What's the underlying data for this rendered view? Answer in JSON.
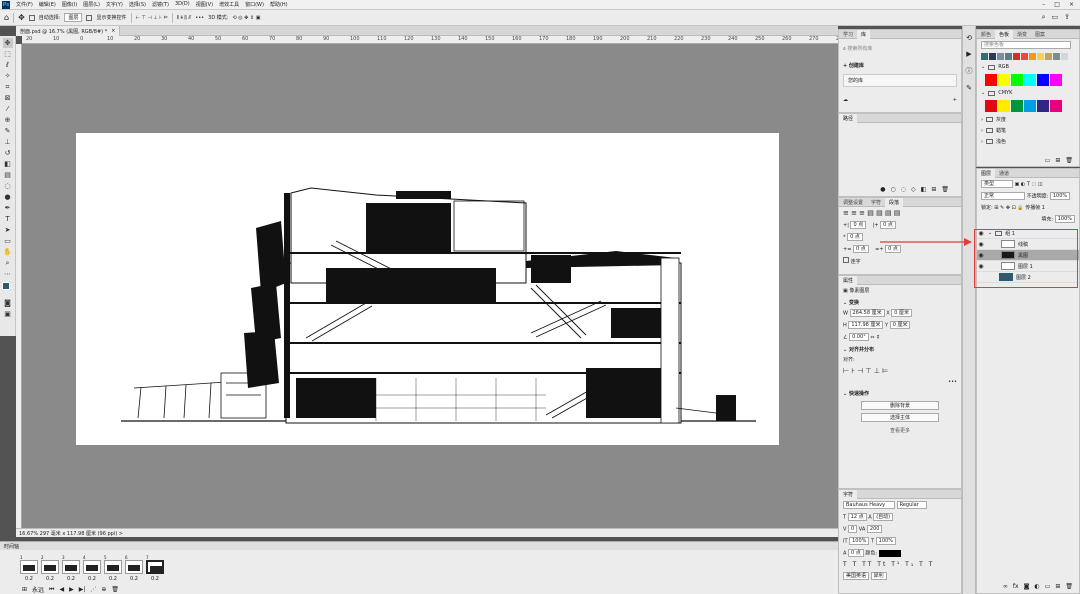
{
  "app": {
    "logo": "Ps"
  },
  "menubar": {
    "items": [
      "文件(F)",
      "编辑(E)",
      "图像(I)",
      "图层(L)",
      "文字(Y)",
      "选择(S)",
      "滤镜(T)",
      "3D(D)",
      "视图(V)",
      "增效工具",
      "窗口(W)",
      "帮助(H)"
    ]
  },
  "options": {
    "auto_select": "自动选择:",
    "auto_select_value": "图层",
    "show_transform": "显示变换控件",
    "mode_3d": "3D 模式:"
  },
  "document": {
    "tab_title": "剖面.psd @ 16.7% (黑图, RGB/8#) *",
    "close": "×"
  },
  "ruler": {
    "h_ticks": [
      "20",
      "10",
      "0",
      "10",
      "20",
      "30",
      "40",
      "50",
      "60",
      "70",
      "80",
      "90",
      "100",
      "110",
      "120",
      "130",
      "140",
      "150",
      "160",
      "170",
      "180",
      "190",
      "200",
      "210",
      "220",
      "230",
      "240",
      "250",
      "260",
      "270",
      "280"
    ]
  },
  "status": {
    "text": "16.67%   297 毫米 x 117.98 厘米 (96 ppi)   >"
  },
  "timeline": {
    "title": "时间轴",
    "frames": [
      {
        "num": "1",
        "delay": "0.2"
      },
      {
        "num": "2",
        "delay": "0.2"
      },
      {
        "num": "3",
        "delay": "0.2"
      },
      {
        "num": "4",
        "delay": "0.2"
      },
      {
        "num": "5",
        "delay": "0.2"
      },
      {
        "num": "6",
        "delay": "0.2"
      },
      {
        "num": "7",
        "delay": "0.2"
      }
    ],
    "loop": "永远"
  },
  "learn_panel": {
    "tabs": [
      "学习",
      "库"
    ],
    "search_placeholder": "搜索所有库",
    "create_new": "+ 创建库",
    "library_name": "您的库"
  },
  "paths_panel": {
    "title": "路径"
  },
  "paragraph_panel": {
    "tabs": [
      "调整设置",
      "字符",
      "段落"
    ],
    "fields": [
      {
        "label": "+|",
        "value": "0 点"
      },
      {
        "label": "|+",
        "value": "0 点"
      },
      {
        "label": "*",
        "value": "0 点"
      },
      {
        "label": "+=",
        "value": "0 点"
      },
      {
        "label": "=+",
        "value": "0 点"
      }
    ],
    "hyphen": "连字"
  },
  "properties_panel": {
    "title": "属性",
    "kind": "像素图层",
    "transform": "变换",
    "w_label": "W",
    "w_value": "264.58 厘米",
    "x_label": "X",
    "x_value": "0 厘米",
    "h_label": "H",
    "h_value": "117.98 厘米",
    "y_label": "Y",
    "y_value": "0 厘米",
    "angle": "0.00°",
    "align": "对齐并分布",
    "align_to": "对齐:",
    "quick_actions": "快速操作",
    "btn_remove_bg": "删除背景",
    "btn_select_subject": "选择主体",
    "more": "查看更多"
  },
  "character_panel": {
    "title": "字符",
    "font": "Bauhaus Heavy",
    "style": "Regular",
    "size": "12 点",
    "leading": "(自动)",
    "kerning": "0",
    "tracking": "200",
    "vscale": "100%",
    "hscale": "100%",
    "baseline": "0 点",
    "color_label": "颜色:",
    "lang": "美国英语",
    "aa": "犀利"
  },
  "swatches_panel": {
    "tabs": [
      "颜色",
      "色板",
      "渐变",
      "图案"
    ],
    "search_placeholder": "搜索色板",
    "recent": [
      "#2f6f73",
      "#2b3b58",
      "#7a8fa6",
      "#5a7d86",
      "#c0392b",
      "#e74c3c",
      "#f39c12",
      "#f7d154",
      "#bfa36a",
      "#7f8c8d",
      "#cfd8dc"
    ],
    "groups": [
      {
        "name": "RGB",
        "colors": [
          "#ff0000",
          "#ffff00",
          "#00ff00",
          "#00ffff",
          "#0000ff",
          "#ff00ff"
        ]
      },
      {
        "name": "CMYK",
        "colors": [
          "#e30613",
          "#ffed00",
          "#009640",
          "#009fe3",
          "#312783",
          "#e6007e"
        ]
      },
      {
        "name": "灰度"
      },
      {
        "name": "蜡笔"
      },
      {
        "name": "浅色"
      }
    ]
  },
  "layers_panel": {
    "tabs": [
      "图层",
      "通道"
    ],
    "filter": "类型",
    "blend": "正常",
    "opacity_label": "不透明度:",
    "opacity": "100%",
    "lock_label": "锁定:",
    "fill_label": "填充:",
    "fill": "100%",
    "frame_prop": "传播帧 1",
    "layers": [
      {
        "name": "组 1",
        "type": "group"
      },
      {
        "name": "线稿",
        "type": "layer"
      },
      {
        "name": "黑图",
        "type": "layer",
        "selected": true
      },
      {
        "name": "图层 1",
        "type": "layer"
      },
      {
        "name": "图层 2",
        "type": "bg"
      }
    ]
  }
}
